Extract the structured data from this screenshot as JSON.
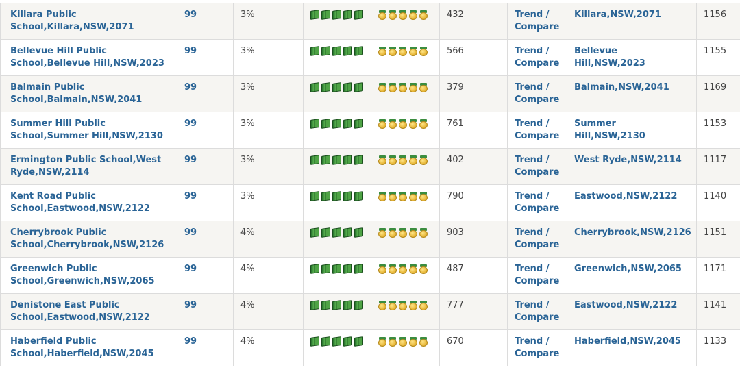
{
  "rows": [
    {
      "school": "Killara Public School,Killara,NSW,2071",
      "score": "99",
      "pct": "3%",
      "enrol": "432",
      "trend": "Trend / Compare",
      "suburb": "Killara,NSW,2071",
      "icsea": "1156"
    },
    {
      "school": "Bellevue Hill Public School,Bellevue Hill,NSW,2023",
      "score": "99",
      "pct": "3%",
      "enrol": "566",
      "trend": "Trend / Compare",
      "suburb": "Bellevue Hill,NSW,2023",
      "icsea": "1155"
    },
    {
      "school": "Balmain Public School,Balmain,NSW,2041",
      "score": "99",
      "pct": "3%",
      "enrol": "379",
      "trend": "Trend / Compare",
      "suburb": "Balmain,NSW,2041",
      "icsea": "1169"
    },
    {
      "school": "Summer Hill Public School,Summer Hill,NSW,2130",
      "score": "99",
      "pct": "3%",
      "enrol": "761",
      "trend": "Trend / Compare",
      "suburb": "Summer Hill,NSW,2130",
      "icsea": "1153"
    },
    {
      "school": "Ermington Public School,West Ryde,NSW,2114",
      "score": "99",
      "pct": "3%",
      "enrol": "402",
      "trend": "Trend / Compare",
      "suburb": "West Ryde,NSW,2114",
      "icsea": "1117"
    },
    {
      "school": "Kent Road Public School,Eastwood,NSW,2122",
      "score": "99",
      "pct": "3%",
      "enrol": "790",
      "trend": "Trend / Compare",
      "suburb": "Eastwood,NSW,2122",
      "icsea": "1140"
    },
    {
      "school": "Cherrybrook Public School,Cherrybrook,NSW,2126",
      "score": "99",
      "pct": "4%",
      "enrol": "903",
      "trend": "Trend / Compare",
      "suburb": "Cherrybrook,NSW,2126",
      "icsea": "1151"
    },
    {
      "school": "Greenwich Public School,Greenwich,NSW,2065",
      "score": "99",
      "pct": "4%",
      "enrol": "487",
      "trend": "Trend / Compare",
      "suburb": "Greenwich,NSW,2065",
      "icsea": "1171"
    },
    {
      "school": "Denistone East Public School,Eastwood,NSW,2122",
      "score": "99",
      "pct": "4%",
      "enrol": "777",
      "trend": "Trend / Compare",
      "suburb": "Eastwood,NSW,2122",
      "icsea": "1141"
    },
    {
      "school": "Haberfield Public School,Haberfield,NSW,2045",
      "score": "99",
      "pct": "4%",
      "enrol": "670",
      "trend": "Trend / Compare",
      "suburb": "Haberfield,NSW,2045",
      "icsea": "1133"
    }
  ],
  "books_per_row": 5,
  "medals_per_row": 5,
  "colors": {
    "link": "#2a6496",
    "row_alt": "#f6f5f2",
    "border": "#dcdcdc"
  }
}
